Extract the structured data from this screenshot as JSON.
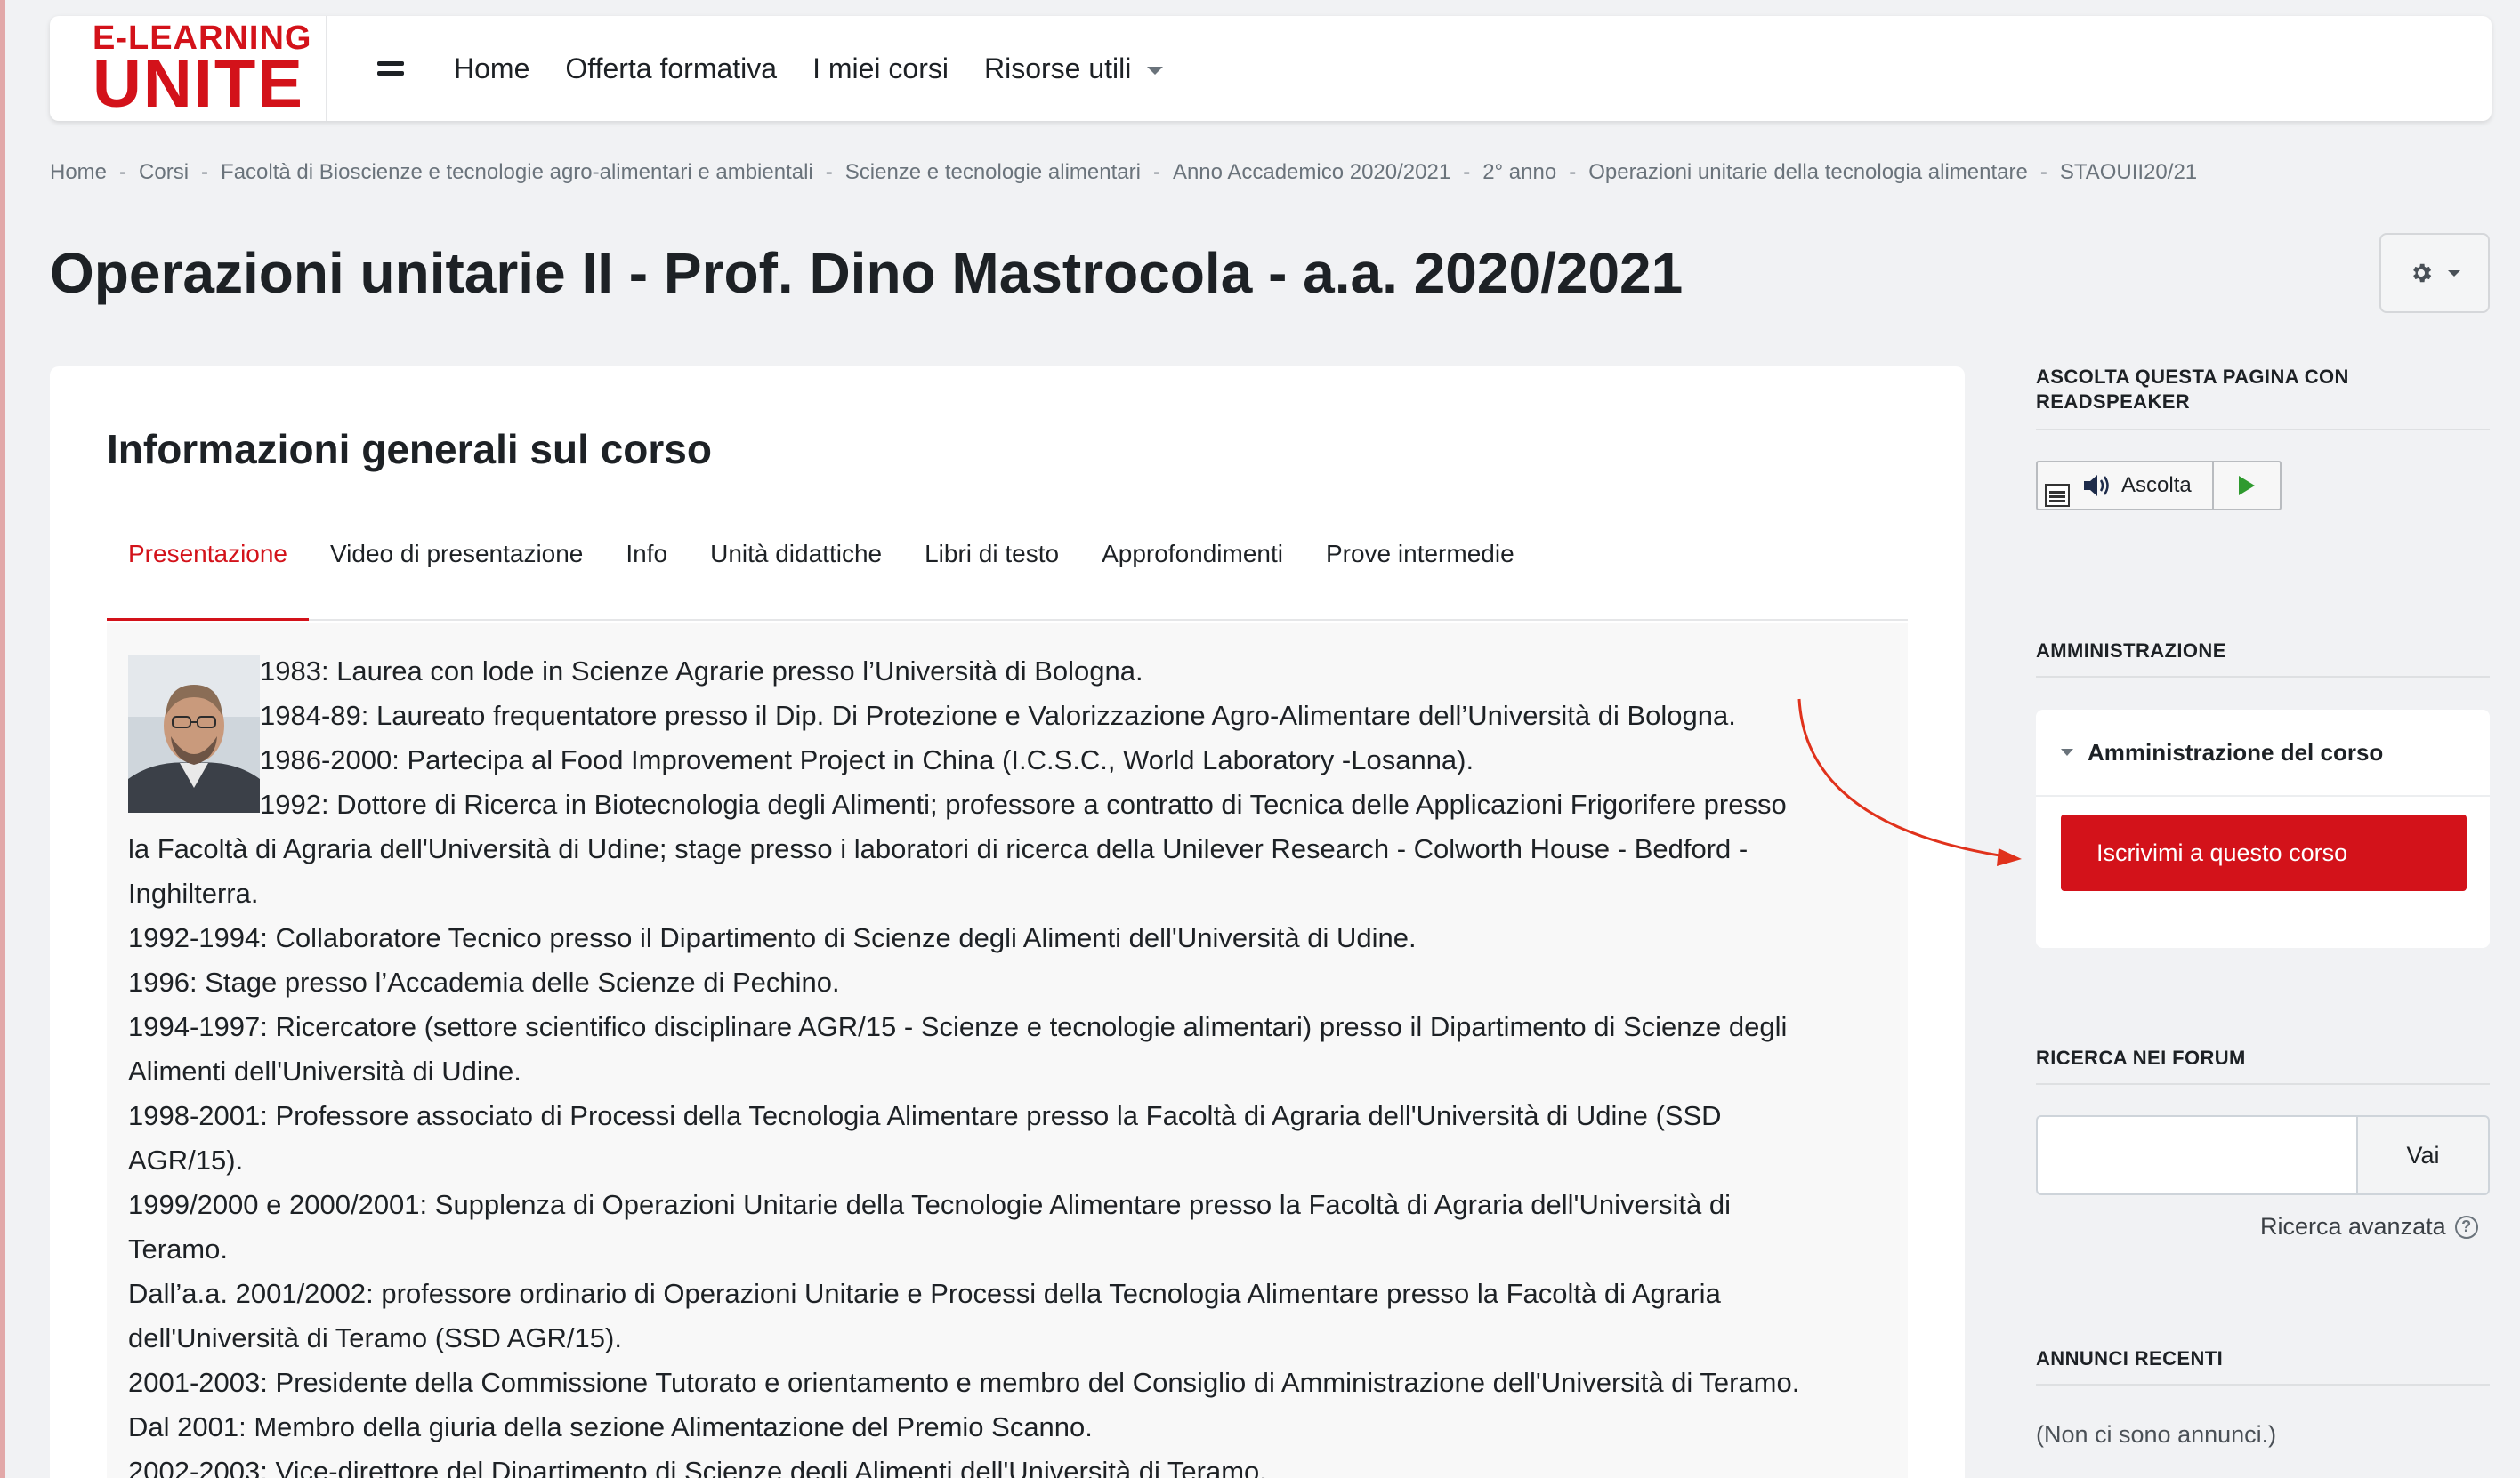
{
  "brand": {
    "top": "E-LEARNING",
    "main": "UNITE"
  },
  "nav": {
    "home": "Home",
    "offerta": "Offerta formativa",
    "corsi": "I miei corsi",
    "risorse": "Risorse utili"
  },
  "breadcrumb": [
    "Home",
    "Corsi",
    "Facoltà di Bioscienze e tecnologie agro-alimentari e ambientali",
    "Scienze e tecnologie alimentari",
    "Anno Accademico 2020/2021",
    "2° anno",
    "Operazioni unitarie della tecnologia alimentare",
    "STAOUII20/21"
  ],
  "breadcrumb_sep": "-",
  "page_title": "Operazioni unitarie II - Prof. Dino Mastrocola - a.a. 2020/2021",
  "main": {
    "section_title": "Informazioni generali sul corso",
    "tabs": [
      "Presentazione",
      "Video di presentazione",
      "Info",
      "Unità didattiche",
      "Libri di testo",
      "Approfondimenti",
      "Prove intermedie"
    ],
    "content_lines": [
      "1983: Laurea con lode in Scienze Agrarie presso l’Università di Bologna.",
      "1984-89: Laureato frequentatore presso il Dip. Di Protezione e Valorizzazione Agro-Alimentare dell’Università di Bologna.",
      "1986-2000: Partecipa al Food Improvement Project in China (I.C.S.C., World Laboratory -Losanna).",
      "1992: Dottore di Ricerca in Biotecnologia degli Alimenti; professore a contratto di Tecnica delle Applicazioni Frigorifere presso",
      "la Facoltà di Agraria dell'Università di Udine; stage presso i laboratori di ricerca della Unilever Research - Colworth House - Bedford -",
      "Inghilterra.",
      "1992-1994: Collaboratore Tecnico presso il Dipartimento di Scienze degli Alimenti dell'Università di Udine.",
      "1996: Stage presso l’Accademia delle Scienze di Pechino.",
      "1994-1997: Ricercatore (settore scientifico disciplinare AGR/15 - Scienze e tecnologie alimentari) presso il Dipartimento di Scienze degli",
      "Alimenti dell'Università di Udine.",
      "1998-2001: Professore associato di Processi della Tecnologia Alimentare presso la Facoltà di Agraria dell'Università di Udine (SSD",
      "AGR/15).",
      "1999/2000 e 2000/2001: Supplenza di Operazioni Unitarie della Tecnologie Alimentare presso la Facoltà di Agraria dell'Università di",
      "Teramo.",
      "Dall’a.a. 2001/2002: professore ordinario di Operazioni Unitarie e Processi della Tecnologia Alimentare presso la Facoltà di Agraria",
      "dell'Università di Teramo (SSD AGR/15).",
      "2001-2003: Presidente della Commissione Tutorato e orientamento e membro del Consiglio di Amministrazione dell'Università di Teramo.",
      "Dal 2001: Membro della giuria della sezione Alimentazione del Premio Scanno.",
      "2002-2003: Vice-direttore del Dipartimento di Scienze degli Alimenti dell'Università di Teramo."
    ]
  },
  "sidebar": {
    "readspeaker": {
      "title": "ASCOLTA QUESTA PAGINA CON READSPEAKER",
      "listen_label": "Ascolta"
    },
    "admin": {
      "title": "AMMINISTRAZIONE",
      "course_admin_label": "Amministrazione del corso",
      "enroll_label": "Iscrivimi a questo corso"
    },
    "forum_search": {
      "title": "RICERCA NEI FORUM",
      "placeholder": "",
      "button_label": "Vai",
      "advanced_label": "Ricerca avanzata"
    },
    "news": {
      "title": "ANNUNCI RECENTI",
      "empty_label": "(Non ci sono annunci.)"
    }
  },
  "colors": {
    "accent": "#d3121a",
    "background": "#f1f2f4",
    "text": "#1d2125"
  }
}
